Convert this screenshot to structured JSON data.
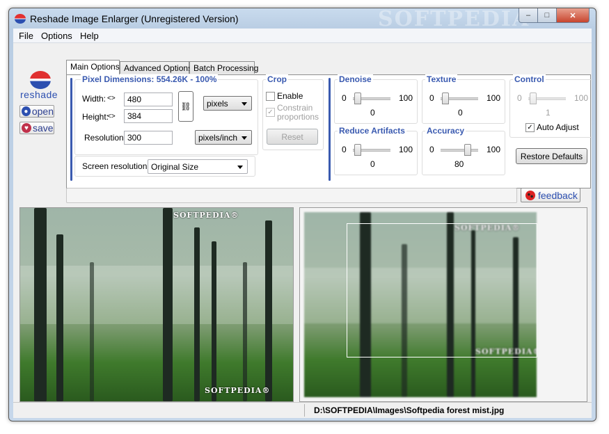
{
  "window": {
    "title": "Reshade Image Enlarger (Unregistered Version)",
    "watermark": "SOFTPEDIA",
    "min_glyph": "–",
    "max_glyph": "□",
    "close_glyph": "✕"
  },
  "menu": [
    "File",
    "Options",
    "Help"
  ],
  "side": {
    "logo": "reshade",
    "open_label": "open",
    "save_label": "save"
  },
  "tabs": [
    "Main Options",
    "Advanced Options",
    "Batch Processing"
  ],
  "pixel": {
    "title": "Pixel Dimensions:  554.26K - 100%",
    "width_label": "Width:",
    "width_value": "480",
    "height_label": "Height:",
    "height_value": "384",
    "unit": "pixels",
    "resolution_label": "Resolution",
    "resolution_value": "300",
    "res_unit": "pixels/inch",
    "arrow": "<>",
    "link_glyph": "⛓"
  },
  "screen": {
    "label": "Screen resolution",
    "value": "Original Size"
  },
  "crop": {
    "title": "Crop",
    "enable": "Enable",
    "constrain": "Constrain proportions",
    "constrain_checked": "✓",
    "reset": "Reset"
  },
  "denoise": {
    "title": "Denoise",
    "min": "0",
    "max": "100",
    "value": "0"
  },
  "texture": {
    "title": "Texture",
    "min": "0",
    "max": "100",
    "value": "0"
  },
  "control": {
    "title": "Control",
    "min": "0",
    "max": "100",
    "value": "1",
    "auto": "Auto Adjust",
    "auto_checked": "✓"
  },
  "reduce": {
    "title": "Reduce Artifacts",
    "min": "0",
    "max": "100",
    "value": "0"
  },
  "accuracy": {
    "title": "Accuracy",
    "min": "0",
    "max": "100",
    "value": "80"
  },
  "restore": "Restore Defaults",
  "feedback": "feedback",
  "image_watermark": "SOFTPEDIA",
  "image_watermark_sym": "®",
  "status": {
    "path": "D:\\SOFTPEDIA\\Images\\Softpedia forest mist.jpg"
  },
  "colors": {
    "accent": "#3a5ab0",
    "title_blue": "#2c4fb0",
    "open_icon": "#2c4fb0",
    "save_icon": "#c0304a"
  }
}
